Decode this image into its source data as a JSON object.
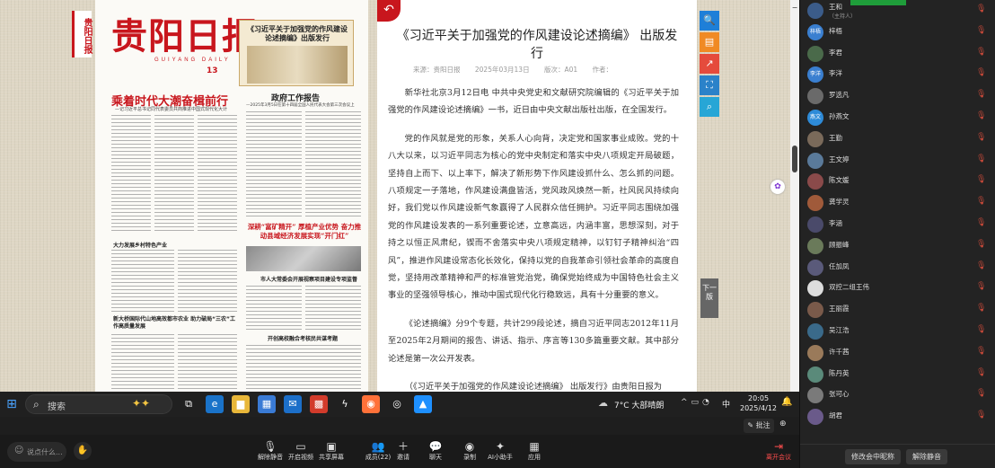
{
  "newspaper": {
    "site_tag": "贵阳日报",
    "masthead": "贵阳日报",
    "masthead_sub": "GUIYANG DAILY",
    "issue_number": "13",
    "ad_title": "《习近平关于加强党的作风建设论述摘编》出版发行",
    "headline_main": "乘着时代大潮奋楫前行",
    "headline_main_sub": "—记习近平总书记同代表委员共商推进中国式现代化大计",
    "headline_report": "政府工作报告",
    "headline_report_sub": "—2025年3月5日在第十四届全国人民代表大会第三次会议上",
    "headline_feature": "深耕“富矿精开” 厚植产业优势 奋力推动县域经济发展实现“开门红”",
    "small_head_1": "大力发展乡村特色产业",
    "small_head_2": "新大桥国际代山地高效都市农业 助力破局“三农”工作高质量发展",
    "small_head_3": "市人大常委会开展视察项目建设专项监督",
    "small_head_4": "开创高校融合考核民共谋考题"
  },
  "reader": {
    "back_icon": "back-arrow",
    "title": "《习近平关于加强党的作风建设论述摘编》 出版发行",
    "source": "来源：贵阳日报",
    "date": "2025年03月13日",
    "edition": "版次：A01",
    "author": "作者：",
    "paragraphs": [
      "新华社北京3月12日电  中共中央党史和文献研究院编辑的《习近平关于加强党的作风建设论述摘编》一书，近日由中央文献出版社出版，在全国发行。",
      "党的作风就是党的形象，关系人心向背，决定党和国家事业成败。党的十八大以来，以习近平同志为核心的党中央制定和落实中央八项规定开局破题，坚持自上而下、以上率下，解决了新形势下作风建设抓什么、怎么抓的问题。八项规定一子落地，作风建设满盘皆活，党风政风焕然一新，社风民风持续向好，我们党以作风建设新气象赢得了人民群众信任拥护。习近平同志围绕加强党的作风建设发表的一系列重要论述，立意高远，内涵丰富，思想深刻，对于持之以恒正风肃纪，锲而不舍落实中央八项规定精神，以钉钉子精神纠治“四风”，推进作风建设常态化长效化，保持以党的自我革命引领社会革命的高度自觉，坚持用改革精神和严的标准管党治党，确保党始终成为中国特色社会主义事业的坚强领导核心，推动中国式现代化行稳致远，具有十分重要的意义。",
      "《论述摘编》分9个专题，共计299段论述，摘自习近平同志2012年11月至2025年2月期间的报告、讲话、指示、序言等130多篇重要文献。其中部分论述是第一次公开发表。",
      "（《习近平关于加强党的作风建设论述摘编》 出版发行》由贵阳日报为"
    ]
  },
  "tools": [
    {
      "name": "search-tool",
      "icon": "🔍",
      "color": "#1e7fd8"
    },
    {
      "name": "catalog-tool",
      "icon": "▤",
      "color": "#f08a24"
    },
    {
      "name": "share-tool",
      "icon": "↗",
      "color": "#e54b3c"
    },
    {
      "name": "fullscreen-tool",
      "icon": "⛶",
      "color": "#2b82c9"
    },
    {
      "name": "zoom-tool",
      "icon": "⌕",
      "color": "#27a6d6"
    }
  ],
  "next_page": "下一版",
  "taskbar": {
    "search_placeholder": "搜索",
    "weather_temp": "7°C  大部晴朗",
    "ime": "中",
    "time": "20:05",
    "date": "2025/4/12",
    "apps": [
      {
        "name": "taskview-app",
        "icon": "⧉",
        "bg": "#202020"
      },
      {
        "name": "edge-app",
        "icon": "e",
        "bg": "#1a73c9"
      },
      {
        "name": "explorer-app",
        "icon": "▆",
        "bg": "#e8b73a"
      },
      {
        "name": "store-app",
        "icon": "▦",
        "bg": "#3a7bd5"
      },
      {
        "name": "mail-app",
        "icon": "✉",
        "bg": "#1c6fc9"
      },
      {
        "name": "office-app",
        "icon": "▩",
        "bg": "#d23b2b"
      },
      {
        "name": "lightning-app",
        "icon": "ϟ",
        "bg": "#202020"
      },
      {
        "name": "firefox-app",
        "icon": "◉",
        "bg": "#ff7139"
      },
      {
        "name": "qq-app",
        "icon": "◎",
        "bg": "#202020"
      },
      {
        "name": "meeting-app",
        "icon": "▲",
        "bg": "#1e90ff"
      }
    ]
  },
  "annotation": {
    "label": "✎ 批注"
  },
  "meeting": {
    "comment_placeholder": "说点什么...",
    "buttons": [
      {
        "name": "unmute-button",
        "icon": "🎙",
        "label": "解除静音"
      },
      {
        "name": "video-button",
        "icon": "▭",
        "label": "开启视频"
      },
      {
        "name": "share-screen-button",
        "icon": "▣",
        "label": "共享屏幕"
      },
      {
        "name": "members-button",
        "icon": "👥",
        "label": "成员(22)"
      },
      {
        "name": "invite-button",
        "icon": "＋",
        "label": "邀请"
      },
      {
        "name": "chat-button",
        "icon": "💬",
        "label": "聊天"
      },
      {
        "name": "record-button",
        "icon": "◉",
        "label": "录制"
      },
      {
        "name": "ai-assistant-button",
        "icon": "✦",
        "label": "AI小助手"
      },
      {
        "name": "apps-button",
        "icon": "▦",
        "label": "应用"
      }
    ],
    "end_label": "离开会议"
  },
  "participants": [
    {
      "name": "王和",
      "sub": "（主持人）",
      "avatar": "",
      "color": "#3b5c8a"
    },
    {
      "name": "梓梧",
      "avatar": "梓梧",
      "color": "#3a7fd0"
    },
    {
      "name": "李君",
      "avatar": "",
      "color": "#4a6a4a"
    },
    {
      "name": "李洋",
      "avatar": "李洋",
      "color": "#3a7fd0"
    },
    {
      "name": "罗选凡",
      "avatar": "",
      "color": "#6a6a6a"
    },
    {
      "name": "孙燕文",
      "avatar": "燕文",
      "color": "#2e8bd8"
    },
    {
      "name": "王勤",
      "avatar": "",
      "color": "#7a6a5a"
    },
    {
      "name": "王文婷",
      "avatar": "",
      "color": "#5a7a9a"
    },
    {
      "name": "陈文媛",
      "avatar": "",
      "color": "#8a4a4a"
    },
    {
      "name": "龚学灵",
      "avatar": "",
      "color": "#a05a3a"
    },
    {
      "name": "李涵",
      "avatar": "",
      "color": "#4a4a6a"
    },
    {
      "name": "顾振峰",
      "avatar": "",
      "color": "#6a7a5a"
    },
    {
      "name": "任加凤",
      "avatar": "",
      "color": "#5a5a7a"
    },
    {
      "name": "双控二组王伟",
      "avatar": "",
      "color": "#dddddd"
    },
    {
      "name": "王丽霞",
      "avatar": "",
      "color": "#7a5a4a"
    },
    {
      "name": "吴江浩",
      "avatar": "",
      "color": "#3a6a8a"
    },
    {
      "name": "许千茜",
      "avatar": "",
      "color": "#9a7a5a"
    },
    {
      "name": "陈丹英",
      "avatar": "",
      "color": "#5a8a7a"
    },
    {
      "name": "张可心",
      "avatar": "",
      "color": "#7a7a7a"
    },
    {
      "name": "胡君",
      "avatar": "",
      "color": "#6a5a8a"
    }
  ],
  "panel_buttons": {
    "rename": "修改会中昵称",
    "unmute": "解除静音"
  }
}
